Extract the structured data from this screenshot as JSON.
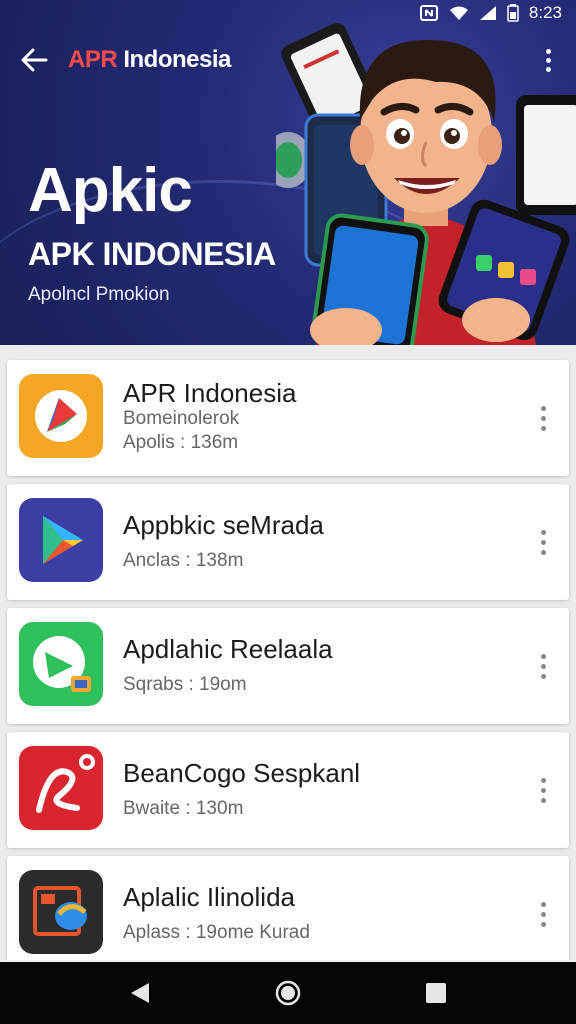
{
  "status_bar": {
    "time": "8:23"
  },
  "app_bar": {
    "title_accent": "APR",
    "title_rest": " Indonesia"
  },
  "hero": {
    "title": "Apkic",
    "subtitle": "APK INDONESIA",
    "tagline": "Apolncl Pmokion"
  },
  "apps": [
    {
      "name": "APR Indonesia",
      "line1": "Bomeinolerok",
      "line2": "Apolis : 136m"
    },
    {
      "name": "Appbkic seMrada",
      "line1": "",
      "line2": "Anclas : 138m"
    },
    {
      "name": "Apdlahic Reelaala",
      "line1": "",
      "line2": "Sqrabs : 19om"
    },
    {
      "name": "BeanCogo Sespkanl",
      "line1": "",
      "line2": "Bwaite : 130m"
    },
    {
      "name": "Aplalic Ilinolida",
      "line1": "",
      "line2": "Aplass : 19ome Kurad"
    }
  ],
  "icons": {
    "back": "arrow-left-icon",
    "more": "more-vertical-icon",
    "nav": [
      "back-triangle-icon",
      "home-circle-icon",
      "recents-square-icon"
    ]
  },
  "colors": {
    "hero_bg": "#232a73",
    "title_accent": "#ff4b4b",
    "nav_bar": "#050505"
  }
}
